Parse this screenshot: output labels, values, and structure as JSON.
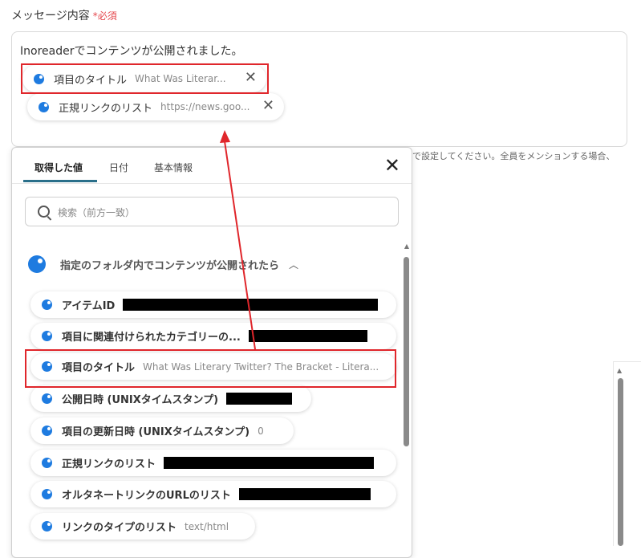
{
  "field": {
    "label": "メッセージ内容",
    "required": "必須",
    "message_text": "Inoreaderでコンテンツが公開されました。"
  },
  "chips": [
    {
      "label": "項目のタイトル",
      "value": "What Was Literar..."
    },
    {
      "label": "正規リンクのリスト",
      "value": "https://news.goo..."
    }
  ],
  "background_hint": "で設定してください。全員をメンションする場合、",
  "panel": {
    "tabs": [
      "取得した値",
      "日付",
      "基本情報"
    ],
    "search_placeholder": "検索（前方一致）",
    "group_title": "指定のフォルダ内でコンテンツが公開されたら",
    "items": [
      {
        "label": "アイテムID",
        "value": ""
      },
      {
        "label": "項目に関連付けられたカテゴリーの...",
        "value": ""
      },
      {
        "label": "項目のタイトル",
        "value": "What Was Literary Twitter? The Bracket - Litera..."
      },
      {
        "label": "公開日時 (UNIXタイムスタンプ)",
        "value": ""
      },
      {
        "label": "項目の更新日時 (UNIXタイムスタンプ)",
        "value": "0"
      },
      {
        "label": "正規リンクのリスト",
        "value": ""
      },
      {
        "label": "オルタネートリンクのURLのリスト",
        "value": ""
      },
      {
        "label": "リンクのタイプのリスト",
        "value": "text/html"
      }
    ]
  },
  "colors": {
    "accent": "#1e7be0",
    "highlight": "#e0262b",
    "tab_underline": "#2a6f8a"
  }
}
